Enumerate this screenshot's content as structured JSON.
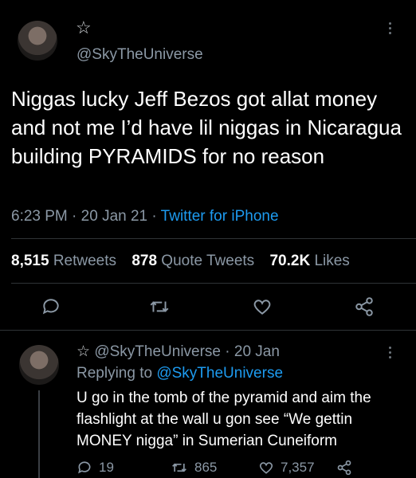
{
  "main_tweet": {
    "star": "☆",
    "handle": "@SkyTheUniverse",
    "text": "Niggas lucky Jeff Bezos got allat money and not me I’d have lil niggas in Nicaragua building PYRAMIDS for no reason",
    "time": "6:23 PM",
    "date": "20 Jan 21",
    "source": "Twitter for iPhone",
    "retweets_count": "8,515",
    "retweets_label": "Retweets",
    "quotes_count": "878",
    "quotes_label": "Quote Tweets",
    "likes_count": "70.2K",
    "likes_label": "Likes"
  },
  "reply": {
    "star": "☆",
    "handle": "@SkyTheUniverse",
    "date": "20 Jan",
    "replying_prefix": "Replying to",
    "replying_to": "@SkyTheUniverse",
    "text": "U go in the tomb of the pyramid and aim the flashlight at the wall u gon see “We gettin MONEY nigga” in Sumerian Cuneiform",
    "replies": "19",
    "retweets": "865",
    "likes": "7,357"
  },
  "colors": {
    "accent": "#1d9bf0",
    "muted": "#8b98a5",
    "text": "#e7e9ea",
    "bg": "#000000"
  },
  "icons": [
    "avatar",
    "more-icon",
    "reply-icon",
    "retweet-icon",
    "like-icon",
    "share-icon"
  ]
}
